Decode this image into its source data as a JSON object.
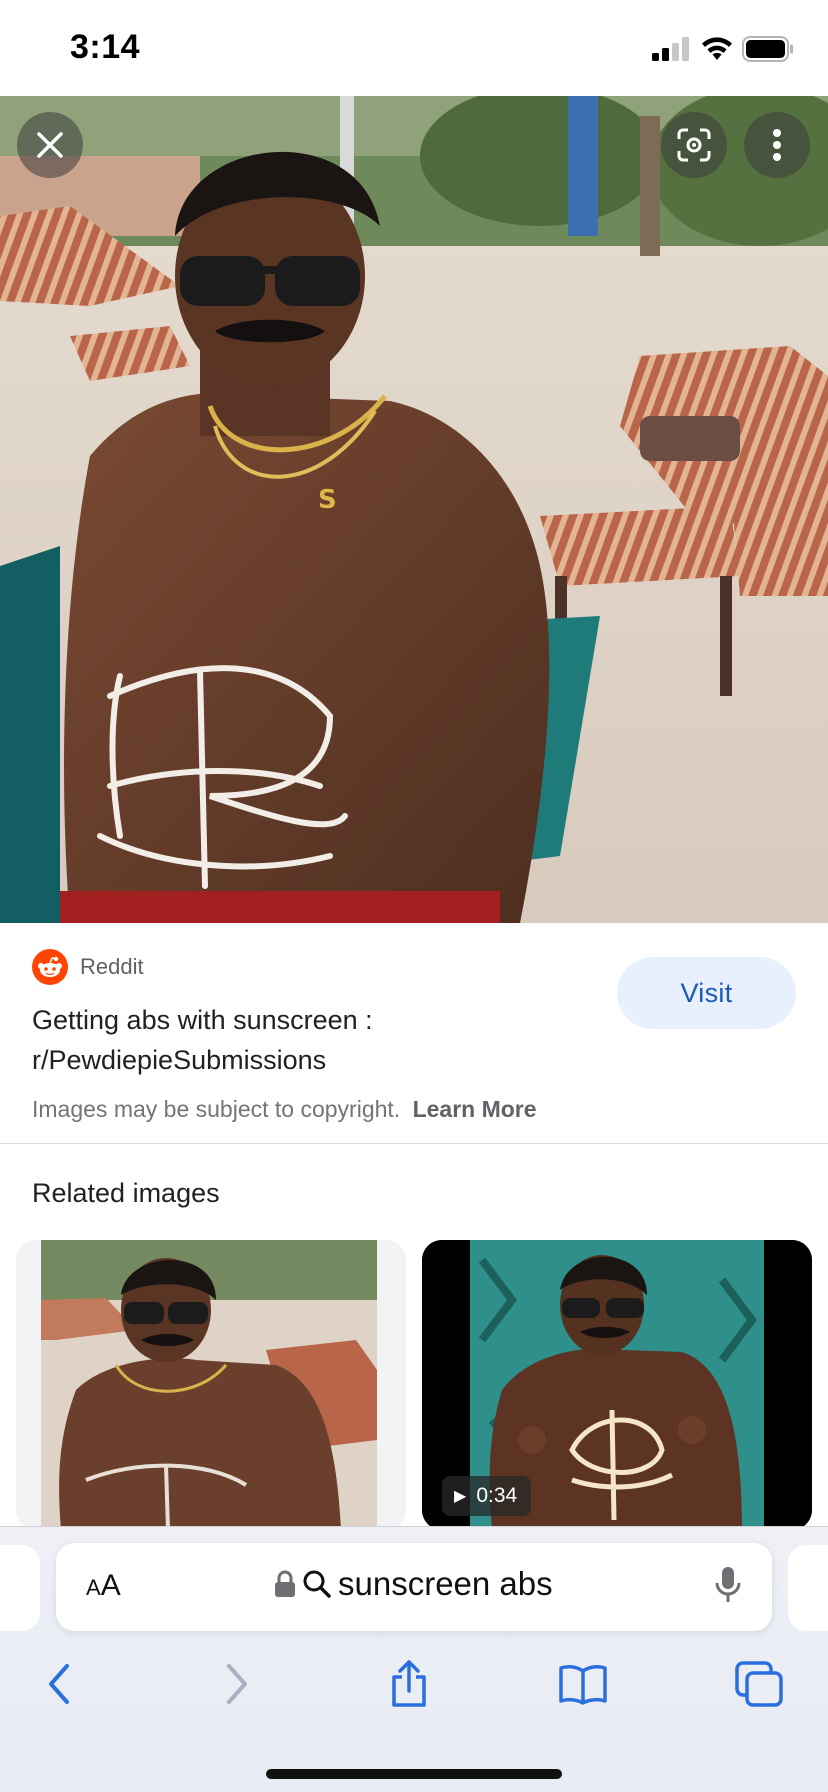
{
  "status_bar": {
    "time": "3:14",
    "icons": [
      "signal-icon",
      "wifi-icon",
      "battery-icon"
    ]
  },
  "viewer": {
    "close_icon": "close-icon",
    "lens_icon": "lens-icon",
    "more_icon": "more-vert-icon"
  },
  "result": {
    "source": "Reddit",
    "source_icon": "reddit-icon",
    "title": "Getting abs with sunscreen : r/PewdiepieSubmissions",
    "visit_label": "Visit",
    "copyright_notice": "Images may be subject to copyright.",
    "learn_more": "Learn More"
  },
  "related": {
    "heading": "Related images",
    "items": [
      {
        "kind": "image"
      },
      {
        "kind": "video",
        "duration": "0:34"
      }
    ]
  },
  "browser": {
    "text_size_label": "AA",
    "url_text": "sunscreen abs",
    "toolbar": [
      "back-icon",
      "forward-icon",
      "share-icon",
      "bookmarks-icon",
      "tabs-icon"
    ]
  },
  "colors": {
    "accent": "#1a5ab8",
    "visit_bg": "#e8f0fe",
    "reddit": "#ff4500"
  }
}
